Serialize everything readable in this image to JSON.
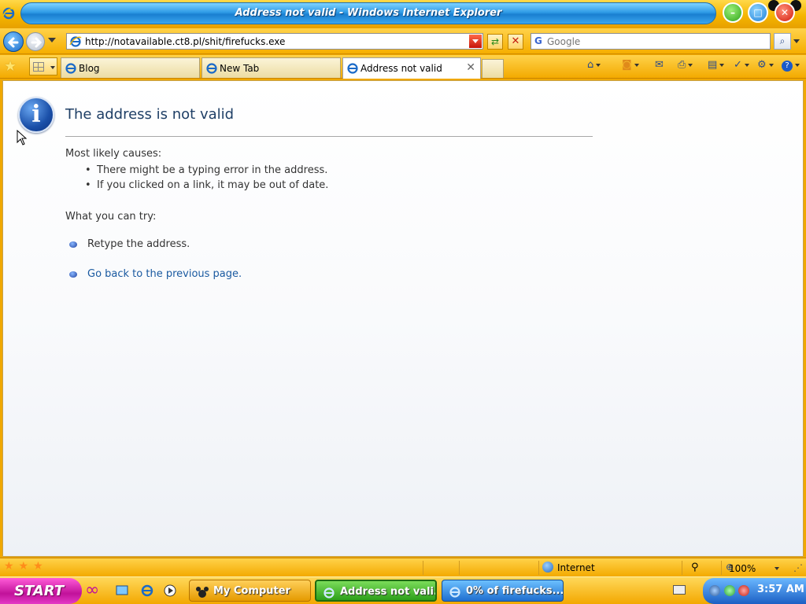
{
  "window": {
    "title": "Address not valid - Windows Internet Explorer"
  },
  "address_bar": {
    "url": "http://notavailable.ct8.pl/shit/firefucks.exe"
  },
  "search": {
    "placeholder": "Google",
    "engine_letter": "G"
  },
  "tabs": [
    {
      "label": "Blog",
      "active": false
    },
    {
      "label": "New Tab",
      "active": false
    },
    {
      "label": "Address not valid",
      "active": true
    }
  ],
  "page": {
    "heading": "The address is not valid",
    "causes_label": "Most likely causes:",
    "causes": [
      "There might be a typing error in the address.",
      "If you clicked on a link, it may be out of date."
    ],
    "try_label": "What you can try:",
    "try_items": [
      {
        "text": "Retype the address.",
        "link": false
      },
      {
        "text": "Go back to the previous page.",
        "link": true
      }
    ]
  },
  "status_bar": {
    "zone": "Internet",
    "zoom": "100%"
  },
  "taskbar": {
    "start_label": "START",
    "tasks": [
      {
        "label": "My Computer"
      },
      {
        "label": "Address not vali..."
      },
      {
        "label": "0% of firefucks...."
      }
    ],
    "clock": "3:57 AM"
  },
  "colors": {
    "chrome_yellow": "#f5b500",
    "title_blue": "#2f9be6",
    "heading_blue": "#1f3f66",
    "link_blue": "#1a5aa0",
    "start_magenta": "#c1129a"
  }
}
